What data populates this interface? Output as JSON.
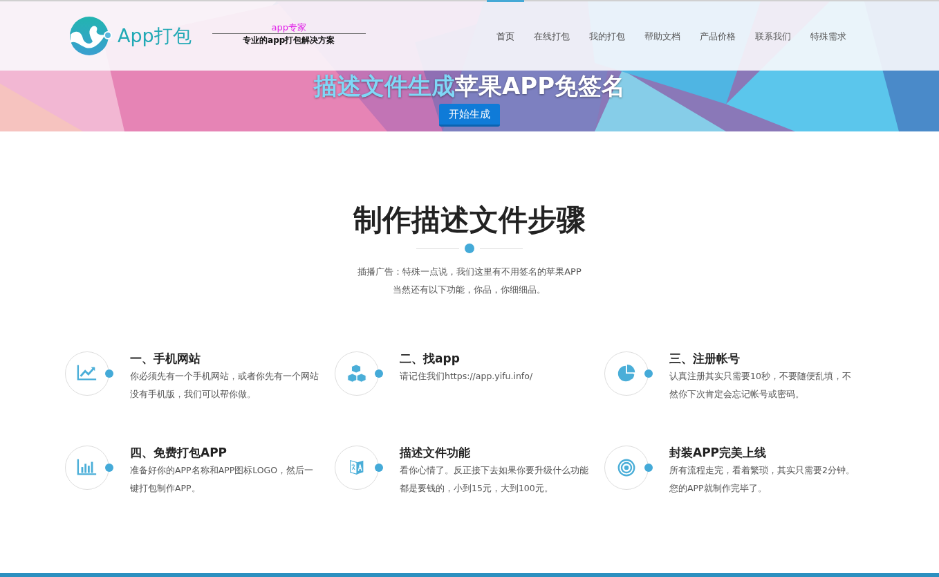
{
  "header": {
    "logo_text": "App打包",
    "slogan_top": "app专家",
    "slogan_bottom": "专业的app打包解决方案",
    "nav": [
      {
        "label": "首页",
        "selected": true
      },
      {
        "label": "在线打包",
        "selected": false
      },
      {
        "label": "我的打包",
        "selected": false
      },
      {
        "label": "帮助文档",
        "selected": false
      },
      {
        "label": "产品价格",
        "selected": false
      },
      {
        "label": "联系我们",
        "selected": false
      },
      {
        "label": "特殊需求",
        "selected": false
      }
    ]
  },
  "hero": {
    "title_accent": "描述文件生成",
    "title": "苹果APP免签名",
    "button": "开始生成"
  },
  "section": {
    "heading": "制作描述文件步骤",
    "intro": [
      "插播广告：特殊一点说，我们这里有不用签名的苹果APP",
      "当然还有以下功能，你品，你细细品。"
    ]
  },
  "features": [
    {
      "kind": "line-chart",
      "title": "一、手机网站",
      "text": "你必须先有一个手机网站，或者你先有一个网站没有手机版，我们可以帮你做。"
    },
    {
      "kind": "cubes",
      "title": "二、找app",
      "text": "请记住我们https://app.yifu.info/"
    },
    {
      "kind": "pie",
      "title": "三、注册帐号",
      "text": "认真注册其实只需要10秒，不要随便乱填，不然你下次肯定会忘记帐号或密码。"
    },
    {
      "kind": "bar-chart",
      "title": "四、免费打包APP",
      "text": "准备好你的APP名称和APP图标LOGO，然后一键打包制作APP。"
    },
    {
      "kind": "translate",
      "title": "描述文件功能",
      "text": "看你心情了。反正接下去如果你要升级什么功能都是要钱的，小到15元，大到100元。"
    },
    {
      "kind": "target",
      "title": "封装APP完美上线",
      "text": "所有流程走完，看着繁琐，其实只需要2分钟。您的APP就制作完毕了。"
    }
  ]
}
